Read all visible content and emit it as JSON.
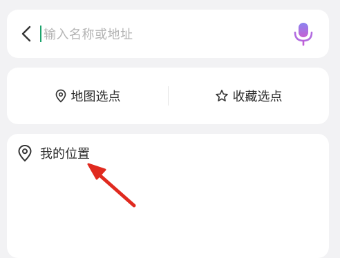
{
  "search": {
    "placeholder": "输入名称或地址",
    "back_icon": "chevron-left-icon",
    "mic_icon": "microphone-icon",
    "caret_color": "#1aa36b",
    "mic_colors": [
      "#7c7cf2",
      "#c05fd6"
    ]
  },
  "options": {
    "map_select": {
      "label": "地图选点",
      "icon": "map-pin-icon"
    },
    "favorite_select": {
      "label": "收藏选点",
      "icon": "star-icon"
    }
  },
  "locations": [
    {
      "label": "我的位置",
      "icon": "map-pin-icon"
    }
  ],
  "annotation": {
    "arrow_color": "#e02a1f",
    "arrow_icon": "red-arrow-icon"
  }
}
